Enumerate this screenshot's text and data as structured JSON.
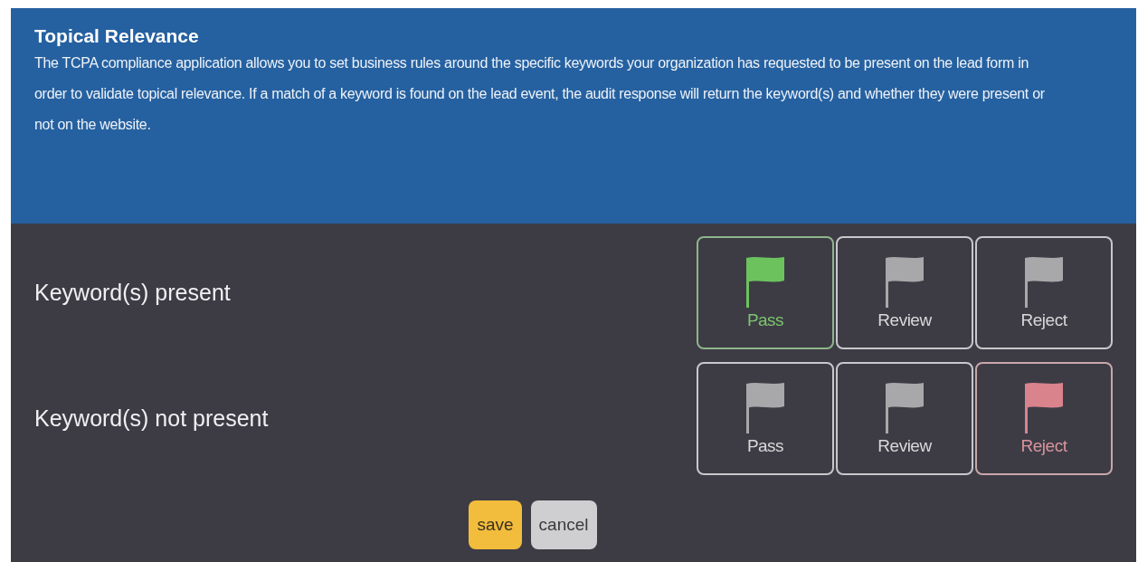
{
  "header": {
    "title": "Topical Relevance",
    "description": "The TCPA compliance application allows you to set business rules around the specific keywords your organization has requested to be present on the lead form in order to validate topical relevance. If a match of a keyword is found on the lead event, the audit response will return the keyword(s) and whether they were present or not on the website."
  },
  "rules": [
    {
      "label": "Keyword(s) present",
      "options": [
        {
          "kind": "pass",
          "label": "Pass",
          "selected": true
        },
        {
          "kind": "review",
          "label": "Review",
          "selected": false
        },
        {
          "kind": "reject",
          "label": "Reject",
          "selected": false
        }
      ]
    },
    {
      "label": "Keyword(s) not present",
      "options": [
        {
          "kind": "pass",
          "label": "Pass",
          "selected": false
        },
        {
          "kind": "review",
          "label": "Review",
          "selected": false
        },
        {
          "kind": "reject",
          "label": "Reject",
          "selected": true
        }
      ]
    }
  ],
  "buttons": [
    {
      "kind": "save",
      "label": "save"
    },
    {
      "kind": "cancel",
      "label": "cancel"
    }
  ]
}
